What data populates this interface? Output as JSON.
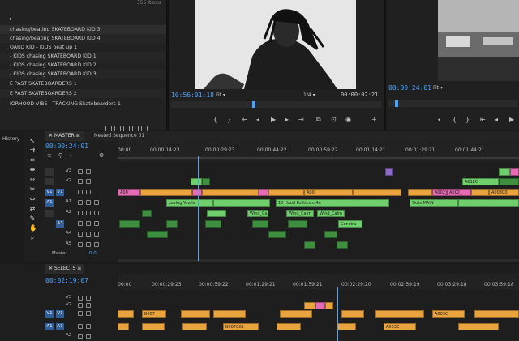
{
  "bin": {
    "item_count": "355 Items",
    "items": [
      "chasing/beating SKATEBOARD KID 3",
      "chasing/beating SKATEBOARD KID 4",
      "OARD KID - KIDS beat up 1",
      "- KIDS chasing SKATEBOARD KID 1",
      "- KIDS chasing SKATEBOARD KID 2",
      "- KIDS chasing SKATEBOARD KID 3",
      "E PAST SKATEBOARDERS 1",
      "E PAST SKATEBOARDERS 2",
      "IORHOOD VIBE - TRACKING Skateboarders 1"
    ]
  },
  "source_monitor": {
    "timecode": "10:56:01:18",
    "fit": "Fit",
    "resolution": "1/4",
    "duration": "00:00:02:21"
  },
  "program_monitor": {
    "timecode": "00:00:24:01",
    "fit": "Fit"
  },
  "history_label": "History",
  "timeline": {
    "tab_active": "MASTER",
    "tab_other": "Nested Sequence 01",
    "timecode": "00:00:24:01",
    "ruler_ticks": [
      "00:00",
      "00:00:14:23",
      "00:00:29:23",
      "00:00:44:22",
      "00:00:59:22",
      "00:01:14:21",
      "00:01:29:21",
      "00:01:44:21"
    ],
    "video_tracks": [
      {
        "src": "",
        "id": "V3"
      },
      {
        "src": "",
        "id": "V2"
      },
      {
        "src": "V1",
        "id": "V1"
      }
    ],
    "audio_tracks": [
      {
        "src": "A1",
        "id": "A1"
      },
      {
        "src": "",
        "id": "A2"
      },
      {
        "src": "",
        "id": "A3"
      },
      {
        "src": "",
        "id": "A4"
      },
      {
        "src": "",
        "id": "A5"
      }
    ],
    "master_label": "Master",
    "master_value": "0.0",
    "clip_labels": {
      "v1_a": "A00",
      "v1_b": "A00",
      "v1_c": "A002_",
      "v1_d": "A002_",
      "v1_e": "A003C0",
      "v2_a": "A01EC",
      "a1_a": "Loving You Is",
      "a1_b": "10 Hood Politics.m4a",
      "a1_c": "Skits MAIN",
      "a2_a": "Wind_Calm",
      "a2_b": "Wind_Calm",
      "a2_c": "Wind_Calm",
      "a2_d": "Constru"
    }
  },
  "selects": {
    "tab": "SELECTS",
    "timecode": "00:02:19:07",
    "ruler_ticks": [
      "00:00",
      "00:00:29:23",
      "00:00:59:22",
      "00:01:29:21",
      "00:01:59:21",
      "00:02:29:20",
      "00:02:59:19",
      "00:03:29:18",
      "00:03:59:18"
    ],
    "tracks": [
      {
        "src": "",
        "id": "V3"
      },
      {
        "src": "",
        "id": "V2"
      },
      {
        "src": "V1",
        "id": "V1"
      },
      {
        "src": "A1",
        "id": "A1"
      },
      {
        "src": "",
        "id": "A2"
      }
    ],
    "clip_labels": {
      "c1": "B007",
      "c2": "B007C01",
      "c3": "A003C",
      "c4": "A003C"
    }
  },
  "colors": {
    "accent_blue": "#4aa4ff",
    "clip_orange": "#e9a43e",
    "clip_pink": "#e56bb4",
    "clip_green": "#6fcf6a"
  }
}
